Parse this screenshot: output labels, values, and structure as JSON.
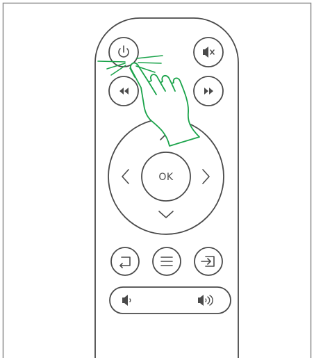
{
  "diagram": {
    "ok_label": "OK",
    "colors": {
      "outline": "#4a4a4a",
      "frame": "#8a8a8a",
      "hand": "#1aa34a",
      "background": "#ffffff"
    },
    "icons": [
      "power-icon",
      "mute-icon",
      "rewind-icon",
      "fast-forward-icon",
      "up-arrow-icon",
      "left-arrow-icon",
      "right-arrow-icon",
      "down-arrow-icon",
      "back-icon",
      "menu-icon",
      "input-source-icon",
      "volume-down-icon",
      "volume-up-icon",
      "pointing-hand-icon"
    ]
  }
}
